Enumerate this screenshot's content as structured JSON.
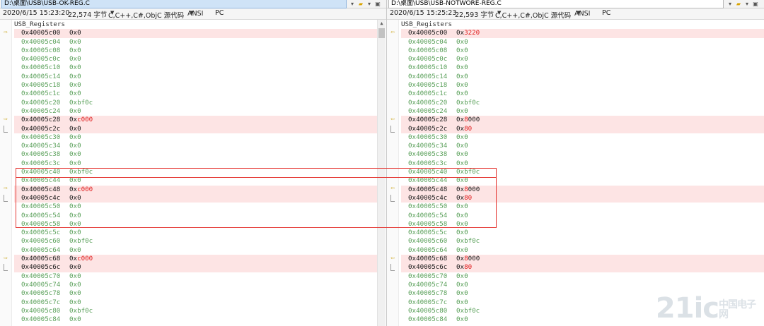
{
  "left": {
    "path": "D:\\桌面\\USB\\USB-OK-REG.C",
    "date": "2020/6/15 15:23:20",
    "size": "22,574 字节",
    "lang": "C,C++,C#,ObjC 源代码",
    "encoding": "ANSI",
    "eol": "PC",
    "header": "USB_Registers",
    "rows": [
      {
        "addr": "0x40005c00",
        "val": "0x0",
        "diff": true
      },
      {
        "addr": "0x40005c04",
        "val": "0x0"
      },
      {
        "addr": "0x40005c08",
        "val": "0x0"
      },
      {
        "addr": "0x40005c0c",
        "val": "0x0"
      },
      {
        "addr": "0x40005c10",
        "val": "0x0"
      },
      {
        "addr": "0x40005c14",
        "val": "0x0"
      },
      {
        "addr": "0x40005c18",
        "val": "0x0"
      },
      {
        "addr": "0x40005c1c",
        "val": "0x0"
      },
      {
        "addr": "0x40005c20",
        "val": "0xbf0c"
      },
      {
        "addr": "0x40005c24",
        "val": "0x0"
      },
      {
        "addr": "0x40005c28",
        "val": "0x",
        "hl": "c000",
        "diff": true
      },
      {
        "addr": "0x40005c2c",
        "val": "0x0",
        "diff": true
      },
      {
        "addr": "0x40005c30",
        "val": "0x0"
      },
      {
        "addr": "0x40005c34",
        "val": "0x0"
      },
      {
        "addr": "0x40005c38",
        "val": "0x0"
      },
      {
        "addr": "0x40005c3c",
        "val": "0x0"
      },
      {
        "addr": "0x40005c40",
        "val": "0xbf0c"
      },
      {
        "addr": "0x40005c44",
        "val": "0x0"
      },
      {
        "addr": "0x40005c48",
        "val": "0x",
        "hl": "c000",
        "diff": true
      },
      {
        "addr": "0x40005c4c",
        "val": "0x0",
        "diff": true
      },
      {
        "addr": "0x40005c50",
        "val": "0x0"
      },
      {
        "addr": "0x40005c54",
        "val": "0x0"
      },
      {
        "addr": "0x40005c58",
        "val": "0x0"
      },
      {
        "addr": "0x40005c5c",
        "val": "0x0"
      },
      {
        "addr": "0x40005c60",
        "val": "0xbf0c"
      },
      {
        "addr": "0x40005c64",
        "val": "0x0"
      },
      {
        "addr": "0x40005c68",
        "val": "0x",
        "hl": "c000",
        "diff": true
      },
      {
        "addr": "0x40005c6c",
        "val": "0x0",
        "diff": true
      },
      {
        "addr": "0x40005c70",
        "val": "0x0"
      },
      {
        "addr": "0x40005c74",
        "val": "0x0"
      },
      {
        "addr": "0x40005c78",
        "val": "0x0"
      },
      {
        "addr": "0x40005c7c",
        "val": "0x0"
      },
      {
        "addr": "0x40005c80",
        "val": "0xbf0c"
      },
      {
        "addr": "0x40005c84",
        "val": "0x0"
      }
    ]
  },
  "right": {
    "path": "D:\\桌面\\USB\\USB-NOTWORE-REG.C",
    "date": "2020/6/15 15:25:23",
    "size": "22,593 字节",
    "lang": "C,C++,C#,ObjC 源代码",
    "encoding": "ANSI",
    "eol": "PC",
    "header": "USB_Registers",
    "rows": [
      {
        "addr": "0x40005c00",
        "val": "0x",
        "hl": "3220",
        "diff": true
      },
      {
        "addr": "0x40005c04",
        "val": "0x0"
      },
      {
        "addr": "0x40005c08",
        "val": "0x0"
      },
      {
        "addr": "0x40005c0c",
        "val": "0x0"
      },
      {
        "addr": "0x40005c10",
        "val": "0x0"
      },
      {
        "addr": "0x40005c14",
        "val": "0x0"
      },
      {
        "addr": "0x40005c18",
        "val": "0x0"
      },
      {
        "addr": "0x40005c1c",
        "val": "0x0"
      },
      {
        "addr": "0x40005c20",
        "val": "0xbf0c"
      },
      {
        "addr": "0x40005c24",
        "val": "0x0"
      },
      {
        "addr": "0x40005c28",
        "val": "0x",
        "hl": "8",
        "tail": "000",
        "diff": true
      },
      {
        "addr": "0x40005c2c",
        "val": "0x",
        "hl": "80",
        "diff": true
      },
      {
        "addr": "0x40005c30",
        "val": "0x0"
      },
      {
        "addr": "0x40005c34",
        "val": "0x0"
      },
      {
        "addr": "0x40005c38",
        "val": "0x0"
      },
      {
        "addr": "0x40005c3c",
        "val": "0x0"
      },
      {
        "addr": "0x40005c40",
        "val": "0xbf0c"
      },
      {
        "addr": "0x40005c44",
        "val": "0x0"
      },
      {
        "addr": "0x40005c48",
        "val": "0x",
        "hl": "8",
        "tail": "000",
        "diff": true
      },
      {
        "addr": "0x40005c4c",
        "val": "0x",
        "hl": "80",
        "diff": true
      },
      {
        "addr": "0x40005c50",
        "val": "0x0"
      },
      {
        "addr": "0x40005c54",
        "val": "0x0"
      },
      {
        "addr": "0x40005c58",
        "val": "0x0"
      },
      {
        "addr": "0x40005c5c",
        "val": "0x0"
      },
      {
        "addr": "0x40005c60",
        "val": "0xbf0c"
      },
      {
        "addr": "0x40005c64",
        "val": "0x0"
      },
      {
        "addr": "0x40005c68",
        "val": "0x",
        "hl": "8",
        "tail": "000",
        "diff": true
      },
      {
        "addr": "0x40005c6c",
        "val": "0x",
        "hl": "80",
        "diff": true
      },
      {
        "addr": "0x40005c70",
        "val": "0x0"
      },
      {
        "addr": "0x40005c74",
        "val": "0x0"
      },
      {
        "addr": "0x40005c78",
        "val": "0x0"
      },
      {
        "addr": "0x40005c7c",
        "val": "0x0"
      },
      {
        "addr": "0x40005c80",
        "val": "0xbf0c"
      },
      {
        "addr": "0x40005c84",
        "val": "0x0"
      }
    ]
  },
  "icons": {
    "diff_marker": "arrow-icon",
    "folder": "folder-icon",
    "dropdown": "chevron-down-icon"
  },
  "colors": {
    "diff_bg": "#fde4e4",
    "same_text": "#5aa05a",
    "changed_char": "#e02020",
    "annotation": "#e53935"
  },
  "watermark": "21ic 中国电子网"
}
